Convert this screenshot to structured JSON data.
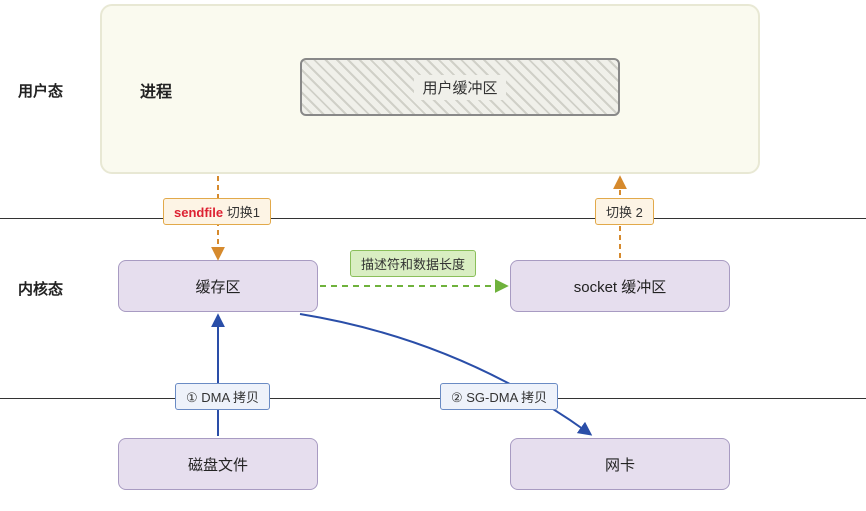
{
  "layers": {
    "user": "用户态",
    "kernel": "内核态"
  },
  "user_area": {
    "process": "进程",
    "user_buffer": "用户缓冲区"
  },
  "nodes": {
    "cache": "缓存区",
    "socket_buf": "socket 缓冲区",
    "disk": "磁盘文件",
    "nic": "网卡"
  },
  "edges": {
    "switch1_prefix": "sendfile",
    "switch1_suffix": " 切换1",
    "switch2": "切换 2",
    "desc_len": "描述符和数据长度",
    "dma": "① DMA 拷贝",
    "sgdma": "② SG-DMA 拷贝"
  }
}
